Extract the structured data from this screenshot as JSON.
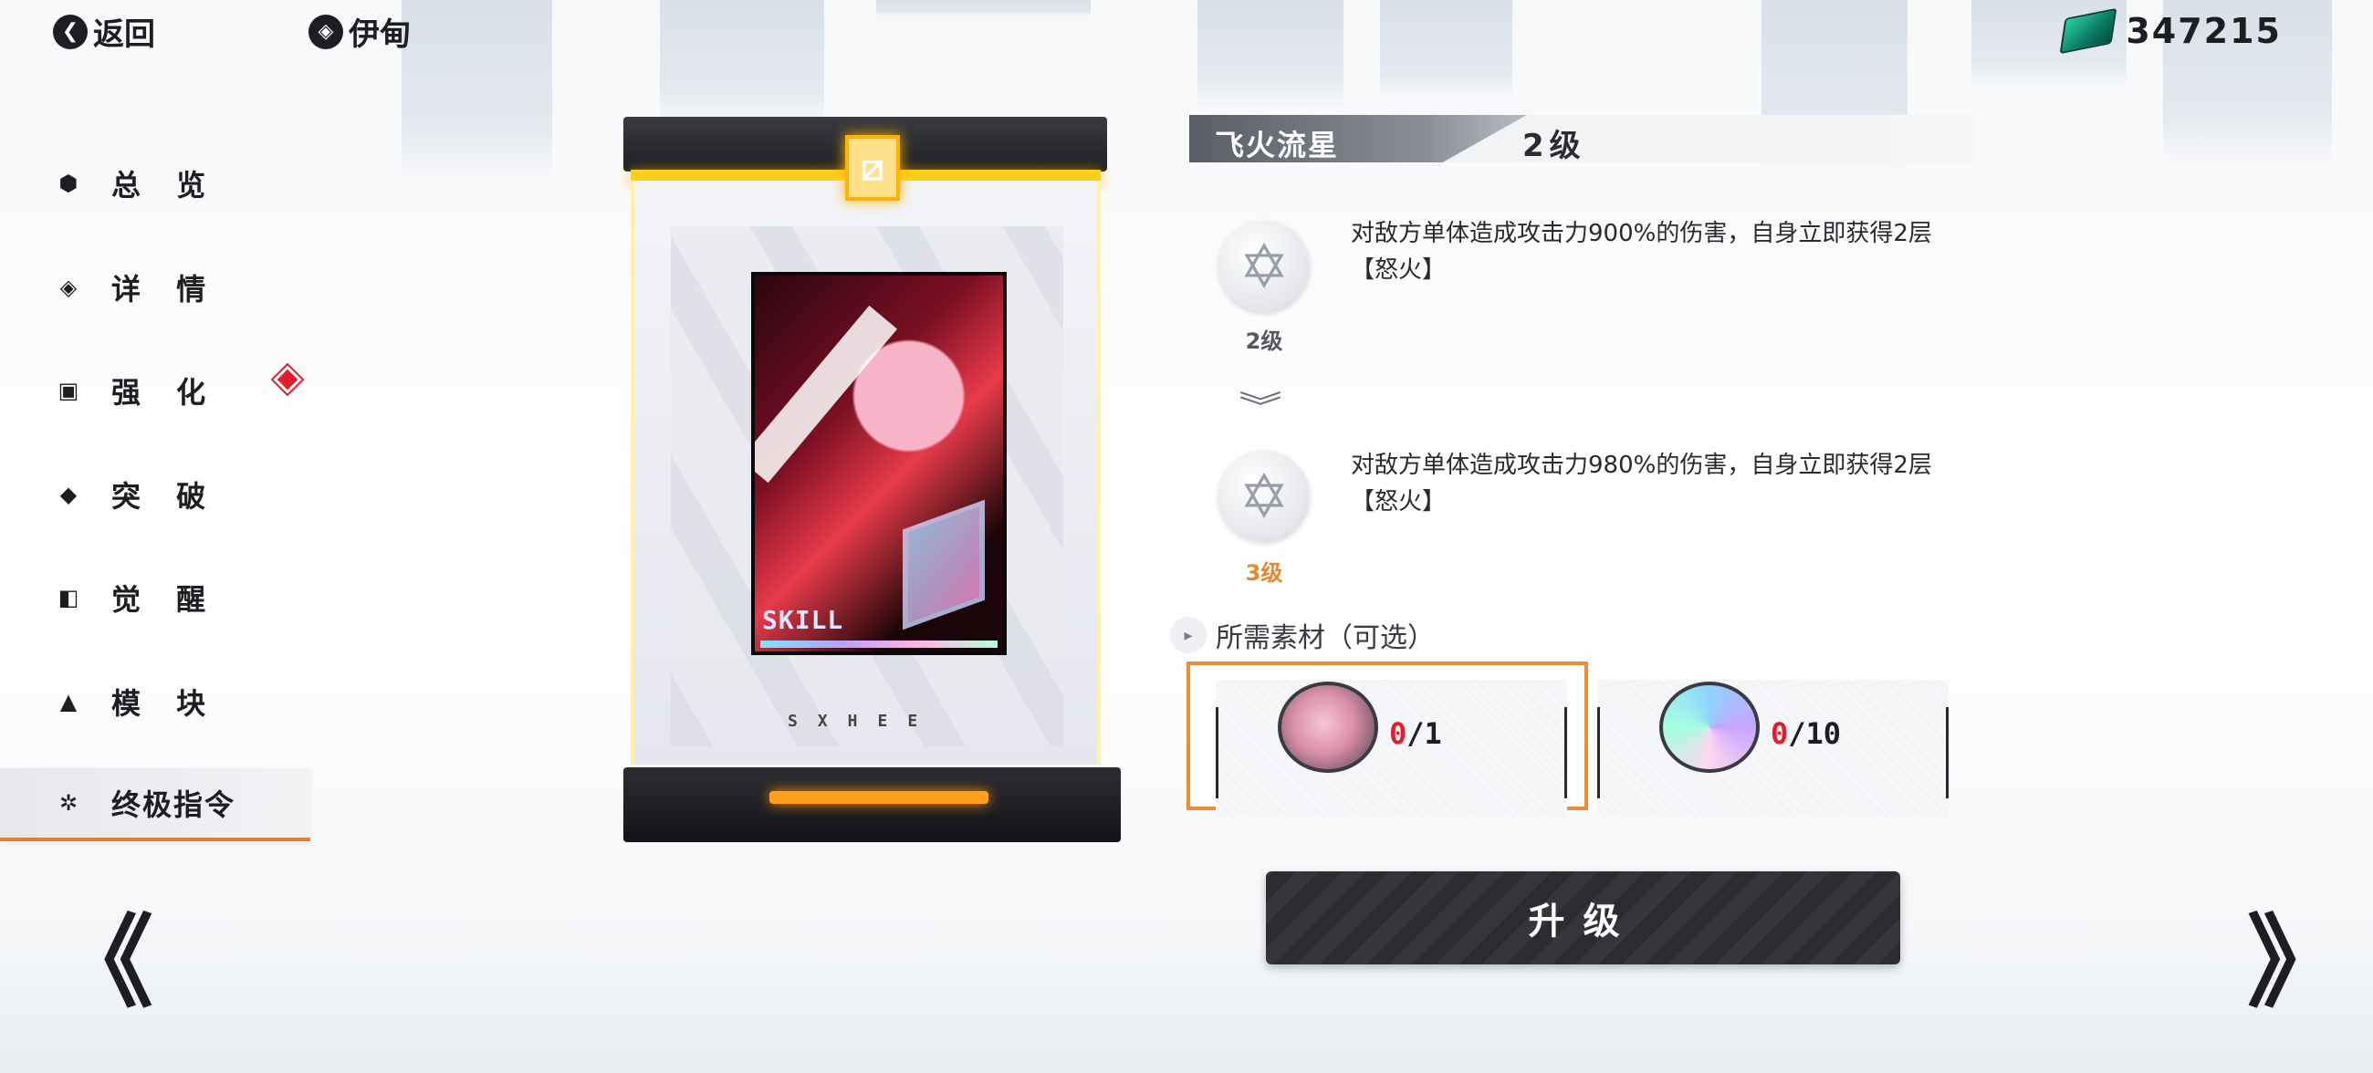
{
  "topbar": {
    "back_label": "返回",
    "character_name": "伊甸",
    "currency_amount": "347215"
  },
  "sidebar": {
    "items": [
      {
        "label": "总 览",
        "icon": "overview-icon"
      },
      {
        "label": "详 情",
        "icon": "details-icon"
      },
      {
        "label": "强 化",
        "icon": "enhance-icon"
      },
      {
        "label": "突 破",
        "icon": "breakthrough-icon"
      },
      {
        "label": "觉 醒",
        "icon": "awaken-icon"
      },
      {
        "label": "模 块",
        "icon": "module-icon"
      },
      {
        "label": "终极指令",
        "icon": "ultimate-command-icon"
      }
    ],
    "active_index": 6,
    "notification_on": "强 化"
  },
  "card": {
    "art_label": "SKILL",
    "code": "SXHEE"
  },
  "skill": {
    "name": "飞火流星",
    "current_level": "2级",
    "current": {
      "level_label": "2级",
      "description": "对敌方单体造成攻击力900%的伤害，自身立即获得2层【怒火】"
    },
    "next": {
      "level_label": "3级",
      "description": "对敌方单体造成攻击力980%的伤害，自身立即获得2层【怒火】"
    }
  },
  "materials": {
    "title": "所需素材（可选）",
    "items": [
      {
        "have": "0",
        "need": "/1",
        "selected": true,
        "icon": "character-chip-icon"
      },
      {
        "have": "0",
        "need": "/10",
        "selected": false,
        "icon": "universal-chip-icon"
      }
    ]
  },
  "actions": {
    "upgrade_label": "升级"
  },
  "colors": {
    "accent_orange": "#ee8b34",
    "warning_red": "#e11d2e",
    "glow_yellow": "#ffcf1a",
    "next_level_orange": "#e8862c"
  }
}
